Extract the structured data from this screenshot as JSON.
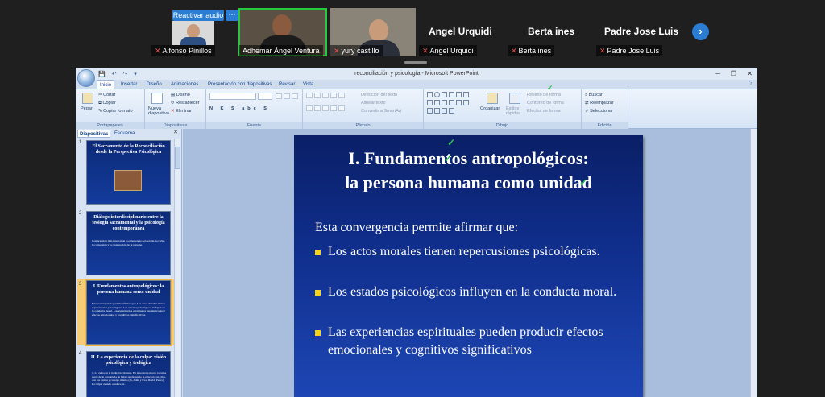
{
  "meeting": {
    "reactivar_audio": "Reactivar audio",
    "more": "···",
    "participants": [
      {
        "name": "Alfonso Pinillos"
      },
      {
        "name": "Adhemar Ángel Ventura"
      },
      {
        "name": "yury castillo"
      },
      {
        "name": "Angel Urquidi"
      },
      {
        "name": "Berta ines"
      },
      {
        "name": "Padre Jose Luis"
      }
    ],
    "big_names": [
      "Angel Urquidi",
      "Berta ines",
      "Padre Jose Luis"
    ],
    "next": "›"
  },
  "ppt": {
    "window_title": "reconciliación y psicología - Microsoft PowerPoint",
    "tabs": [
      "Inicio",
      "Insertar",
      "Diseño",
      "Animaciones",
      "Presentación con diapositivas",
      "Revisar",
      "Vista"
    ],
    "ribbon": {
      "portapapeles": {
        "label": "Portapapeles",
        "pegar": "Pegar",
        "cortar": "Cortar",
        "copiar": "Copiar",
        "copiar_formato": "Copiar formato"
      },
      "diapositivas": {
        "label": "Diapositivas",
        "nueva": "Nueva diapositiva",
        "diseno": "Diseño",
        "restablecer": "Restablecer",
        "eliminar": "Eliminar"
      },
      "fuente": {
        "label": "Fuente"
      },
      "parrafo": {
        "label": "Párrafo",
        "direccion": "Dirección del texto",
        "alinear": "Alinear texto",
        "smartart": "Convertir a SmartArt"
      },
      "dibujo": {
        "label": "Dibujo",
        "organizar": "Organizar",
        "estilos": "Estilos rápidos",
        "relleno": "Relleno de forma",
        "contorno": "Contorno de forma",
        "efectos": "Efectos de forma"
      },
      "edicion": {
        "label": "Edición",
        "buscar": "Buscar",
        "reemplazar": "Reemplazar",
        "seleccionar": "Seleccionar"
      }
    },
    "panel_tabs": [
      "Diapositivas",
      "Esquema"
    ],
    "thumbnails": [
      {
        "num": "1",
        "title": "El Sacramento de la Reconciliación desde la Perspectiva Psicológica"
      },
      {
        "num": "2",
        "title": "Diálogo interdisciplinario entre la teología sacramental y la psicología contemporánea",
        "text": "Comprensión más integral de la experiencia del perdón, la culpa, la conversión y la restauración de la persona."
      },
      {
        "num": "3",
        "title": "I. Fundamentos antropológicos: la persona humana como unidad",
        "text": "Esta convergencia permite afirmar que: Los actos morales tienen repercusiones psicológicas. Los estados psicológicos influyen en la conducta moral. Las experiencias espirituales pueden producir efectos emocionales y cognitivos significativos."
      },
      {
        "num": "4",
        "title": "II. La experiencia de la culpa: visión psicológica y teológica",
        "text": "1. La culpa en la tradición cristiana. En la teología moral, la culpa surge de la conciencia de haber quebrantado la relación con Dios, con los demás y consigo mismo (Jn, Adán y Eva, David, Pedro). La culpa, cuando conduce al..."
      }
    ],
    "slide": {
      "title_line1": "I. Fundamentos antropológicos:",
      "title_line2": "la persona humana como unidad",
      "intro": "Esta convergencia permite afirmar que:",
      "bullets": [
        "Los actos morales tienen repercusiones psicológicas.",
        "Los estados psicológicos influyen en la conducta moral.",
        "Las experiencias espirituales pueden producir efectos emocionales y cognitivos significativos"
      ]
    }
  }
}
